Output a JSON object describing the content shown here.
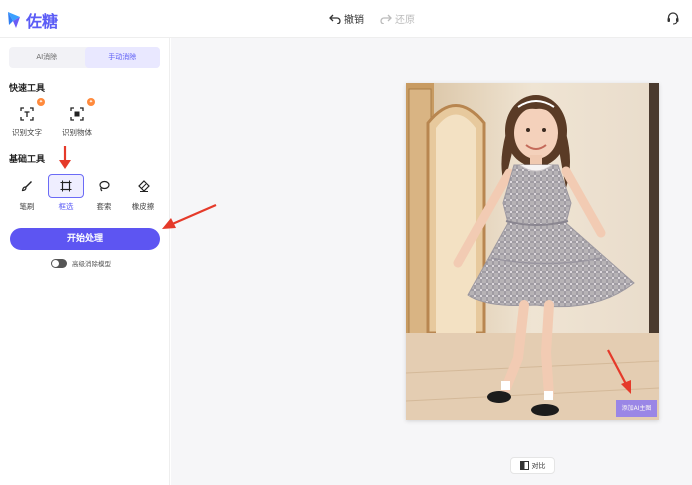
{
  "app": {
    "name": "佐糖",
    "brand_color": "#5b5cf6"
  },
  "toolbar": {
    "undo_label": "撤销",
    "redo_label": "还原"
  },
  "tabs": [
    {
      "label": "AI消除",
      "active": false
    },
    {
      "label": "手动消除",
      "active": true
    }
  ],
  "quick_tools": {
    "title": "快速工具",
    "items": [
      {
        "label": "识别文字",
        "icon": "scan-text-icon"
      },
      {
        "label": "识别物体",
        "icon": "scan-object-icon"
      }
    ]
  },
  "basic_tools": {
    "title": "基础工具",
    "items": [
      {
        "label": "笔刷",
        "icon": "brush-icon"
      },
      {
        "label": "框选",
        "icon": "box-select-icon",
        "selected": true
      },
      {
        "label": "套索",
        "icon": "lasso-icon"
      },
      {
        "label": "橡皮擦",
        "icon": "eraser-icon"
      }
    ]
  },
  "start_button": {
    "label": "开始处理",
    "color": "#5d55f2"
  },
  "advanced_model": {
    "label": "高级消除模型",
    "enabled": false
  },
  "canvas": {
    "ai_button_label": "添加AI主图",
    "compare_label": "对比"
  },
  "annotation_color": "#e53a2a"
}
